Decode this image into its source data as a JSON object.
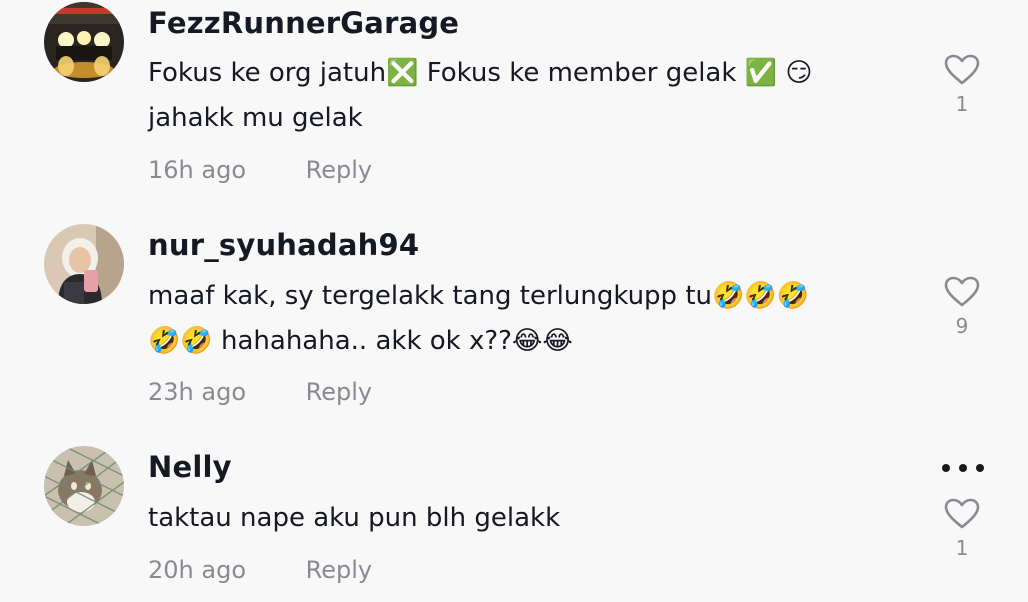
{
  "comments": [
    {
      "username": "FezzRunnerGarage",
      "line1": "Fokus ke org jatuh❎ Fokus ke member gelak ✅ 😏",
      "line2": "jahakk mu gelak",
      "time": "16h ago",
      "reply": "Reply",
      "likes": "1",
      "avatar_icon": "garage-lights-avatar"
    },
    {
      "username": "nur_syuhadah94",
      "line1": "maaf kak, sy tergelakk tang terlungkupp tu🤣🤣🤣",
      "line2": "🤣🤣 hahahaha.. akk ok x??😂😂",
      "time": "23h ago",
      "reply": "Reply",
      "likes": "9",
      "avatar_icon": "woman-hijab-avatar"
    },
    {
      "username": "Nelly",
      "line1": "taktau nape aku pun blh gelakk",
      "line2": "",
      "time": "20h ago",
      "reply": "Reply",
      "likes": "1",
      "avatar_icon": "cat-avatar"
    }
  ],
  "colors": {
    "background": "#f8f8f8",
    "text": "#161823",
    "muted": "#8a8b91"
  }
}
